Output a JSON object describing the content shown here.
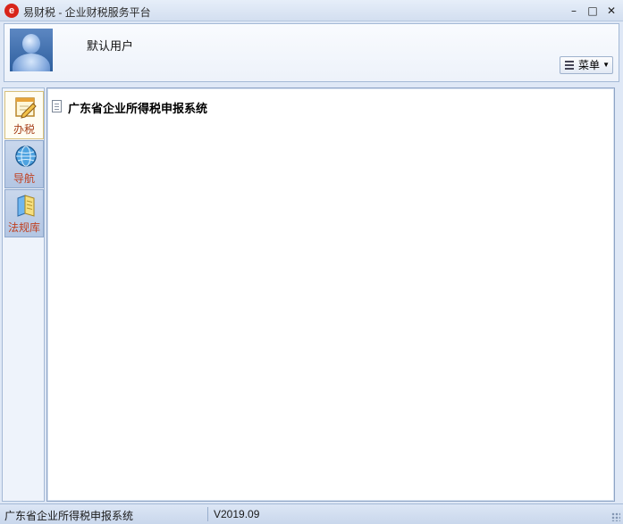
{
  "window": {
    "icon_glyph": "e",
    "title": "易财税 - 企业财税服务平台",
    "controls": {
      "minimize": "–",
      "maximize": "□",
      "close": "✕"
    }
  },
  "header": {
    "username": "默认用户",
    "menu_label": "菜单",
    "menu_caret": "▼"
  },
  "nav": {
    "items": [
      {
        "label": "办税",
        "icon": "pencil-paper-icon",
        "state": "active"
      },
      {
        "label": "导航",
        "icon": "globe-icon",
        "state": "inactive"
      },
      {
        "label": "法规库",
        "icon": "book-icon",
        "state": "inactive"
      }
    ]
  },
  "main": {
    "entries": [
      {
        "label": "广东省企业所得税申报系统",
        "icon": "document-icon"
      }
    ]
  },
  "status": {
    "system_name": "广东省企业所得税申报系统",
    "version": "V2019.09"
  },
  "colors": {
    "accent_red": "#d8251b",
    "nav_label": "#c04020",
    "frame_blue": "#a4b9d6"
  }
}
